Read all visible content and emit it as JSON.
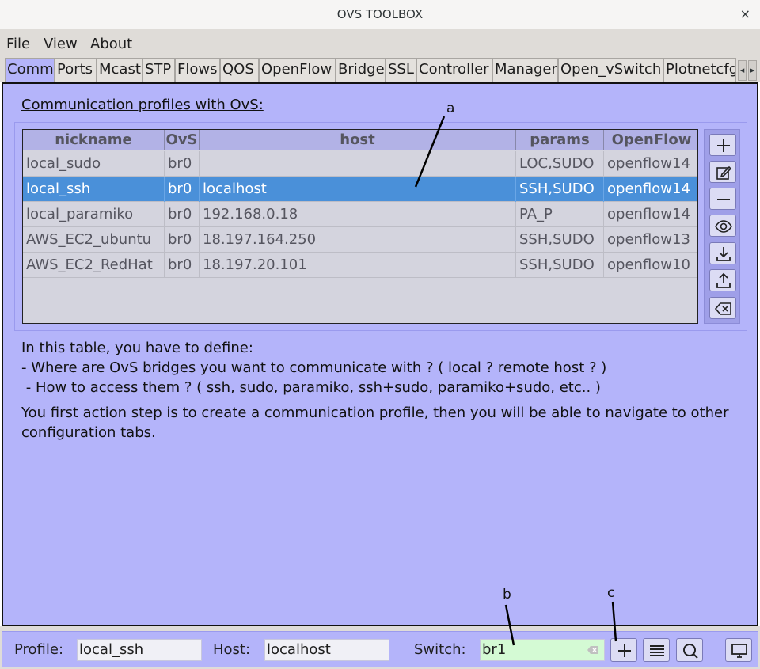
{
  "window": {
    "title": "OVS TOOLBOX",
    "close_glyph": "×"
  },
  "menu": {
    "items": [
      "File",
      "View",
      "About"
    ]
  },
  "tabs": [
    "Comm",
    "Ports",
    "Mcast",
    "STP",
    "Flows",
    "QOS",
    "OpenFlow",
    "Bridge",
    "SSL",
    "Controller",
    "Manager",
    "Open_vSwitch",
    "Plotnetcfg"
  ],
  "tabs_active": "Comm",
  "tab_scroll": {
    "left": "◂",
    "right": "▸"
  },
  "panel": {
    "heading": "Communication profiles with OvS:",
    "columns": [
      "nickname",
      "OvS",
      "host",
      "params",
      "OpenFlow"
    ],
    "rows": [
      [
        "local_sudo",
        "br0",
        "",
        "LOC,SUDO",
        "openflow14"
      ],
      [
        "local_ssh",
        "br0",
        "localhost",
        "SSH,SUDO",
        "openflow14"
      ],
      [
        "local_paramiko",
        "br0",
        "192.168.0.18",
        "PA_P",
        "openflow14"
      ],
      [
        "AWS_EC2_ubuntu",
        "br0",
        "18.197.164.250",
        "SSH,SUDO",
        "openflow13"
      ],
      [
        "AWS_EC2_RedHat",
        "br0",
        "18.197.20.101",
        "SSH,SUDO",
        "openflow10"
      ]
    ],
    "selected_row": "local_ssh",
    "side_buttons": [
      "plus-icon",
      "edit-icon",
      "minus-icon",
      "eye-icon",
      "download-icon",
      "upload-icon",
      "backspace-icon"
    ],
    "info": {
      "line1": "In this table, you have to define:",
      "line2": "- Where are OvS bridges you want to communicate with ? ( local ? remote host ? )",
      "line3": " - How to access them ? ( ssh, sudo, paramiko, ssh+sudo, paramiko+sudo, etc.. )",
      "line4": "You first action step is to create a communication profile, then you will be able to navigate to other",
      "line5": "configuration tabs."
    }
  },
  "annotations": {
    "a": "a",
    "b": "b",
    "c": "c"
  },
  "bottom": {
    "profile_label": "Profile:",
    "profile_value": "local_ssh",
    "host_label": "Host:",
    "host_value": "localhost",
    "switch_label": "Switch:",
    "switch_value": "br1",
    "buttons": [
      "plus-icon",
      "list-icon",
      "search-icon",
      "monitor-icon"
    ]
  },
  "colors": {
    "panel": "#b4b4fa",
    "selection": "#4a90d9",
    "switch_field": "#d4fad4"
  }
}
